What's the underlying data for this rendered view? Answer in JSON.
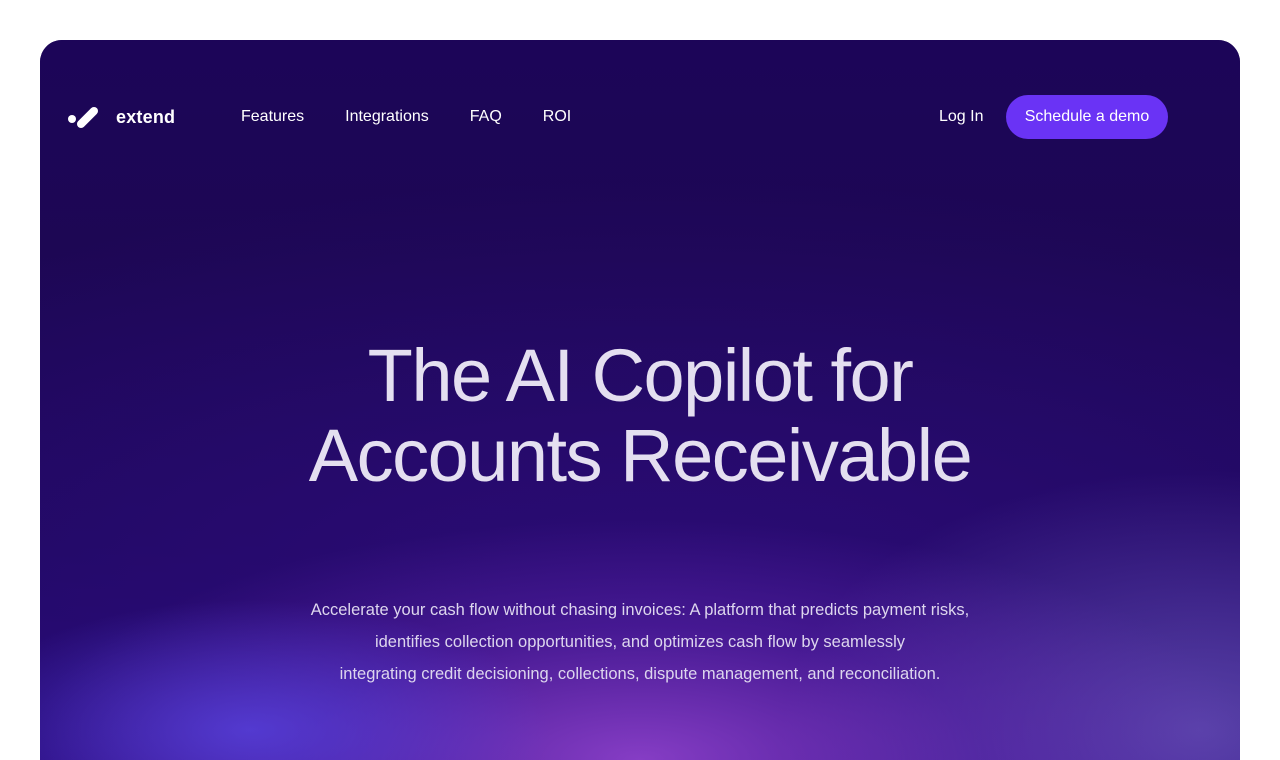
{
  "brand": {
    "name": "extend",
    "logo_icon": "extend-logo-icon"
  },
  "nav": {
    "links": [
      "Features",
      "Integrations",
      "FAQ",
      "ROI"
    ],
    "login_label": "Log In",
    "cta_label": "Schedule a demo"
  },
  "hero": {
    "title_line1": "The AI Copilot for",
    "title_line2": "Accounts Receivable",
    "subtitle_line1": "Accelerate your cash flow without chasing invoices: A platform that predicts payment risks,",
    "subtitle_line2": "identifies collection opportunities, and optimizes cash flow by seamlessly",
    "subtitle_line3": "integrating credit decisioning, collections, dispute management, and reconciliation."
  },
  "colors": {
    "hero_background": "#1b0653",
    "cta_background": "#6a33f5",
    "page_background": "#ffffff"
  }
}
